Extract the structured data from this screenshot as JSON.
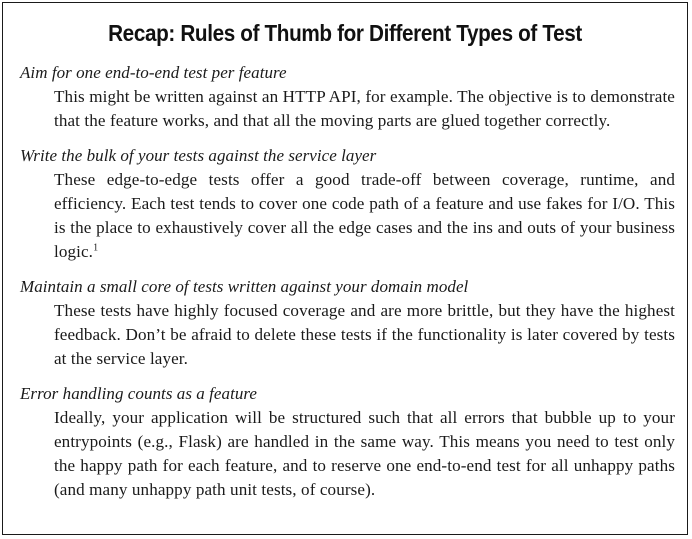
{
  "sidebar": {
    "title": "Recap: Rules of Thumb for Different Types of Test",
    "entries": [
      {
        "term": "Aim for one end-to-end test per feature",
        "description": "This might be written against an HTTP API, for example. The objective is to demonstrate that the feature works, and that all the moving parts are glued together correctly."
      },
      {
        "term": "Write the bulk of your tests against the service layer",
        "description": "These edge-to-edge tests offer a good trade-off between coverage, runtime, and efficiency. Each test tends to cover one code path of a feature and use fakes for I/O. This is the place to exhaustively cover all the edge cases and the ins and outs of your business logic.",
        "footnote": "1"
      },
      {
        "term": "Maintain a small core of tests written against your domain model",
        "description": "These tests have highly focused coverage and are more brittle, but they have the highest feedback. Don’t be afraid to delete these tests if the functionality is later covered by tests at the service layer."
      },
      {
        "term": "Error handling counts as a feature",
        "description": "Ideally, your application will be structured such that all errors that bubble up to your entrypoints (e.g., Flask) are handled in the same way. This means you need to test only the happy path for each feature, and to reserve one end-to-end test for all unhappy paths (and many unhappy path unit tests, of course)."
      }
    ]
  }
}
